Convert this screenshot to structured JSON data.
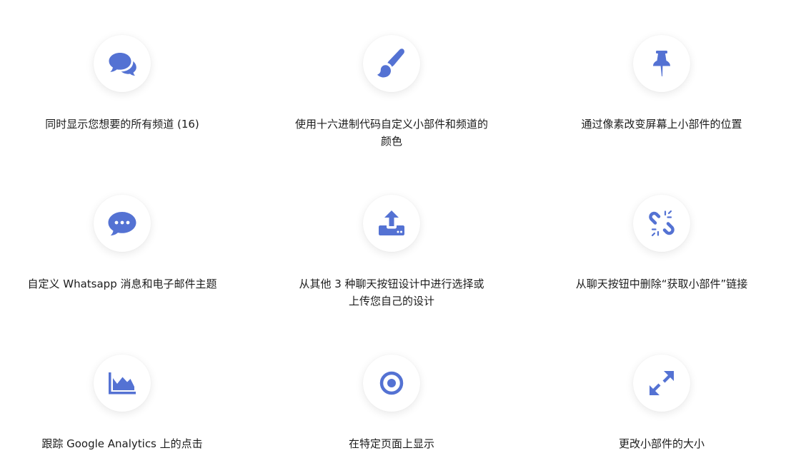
{
  "accent_color": "#5472d3",
  "features": [
    {
      "icon": "chat-bubbles-icon",
      "label": "同时显示您想要的所有频道 (16)"
    },
    {
      "icon": "paintbrush-icon",
      "label": "使用十六进制代码自定义小部件和频道的颜色"
    },
    {
      "icon": "pushpin-icon",
      "label": "通过像素改变屏幕上小部件的位置"
    },
    {
      "icon": "chat-dots-icon",
      "label": "自定义 Whatsapp 消息和电子邮件主题"
    },
    {
      "icon": "upload-icon",
      "label": "从其他 3 种聊天按钮设计中进行选择或上传您自己的设计"
    },
    {
      "icon": "unlink-icon",
      "label": "从聊天按钮中删除“获取小部件”链接"
    },
    {
      "icon": "area-chart-icon",
      "label": "跟踪 Google Analytics 上的点击"
    },
    {
      "icon": "target-icon",
      "label": "在特定页面上显示"
    },
    {
      "icon": "resize-arrows-icon",
      "label": "更改小部件的大小"
    }
  ]
}
